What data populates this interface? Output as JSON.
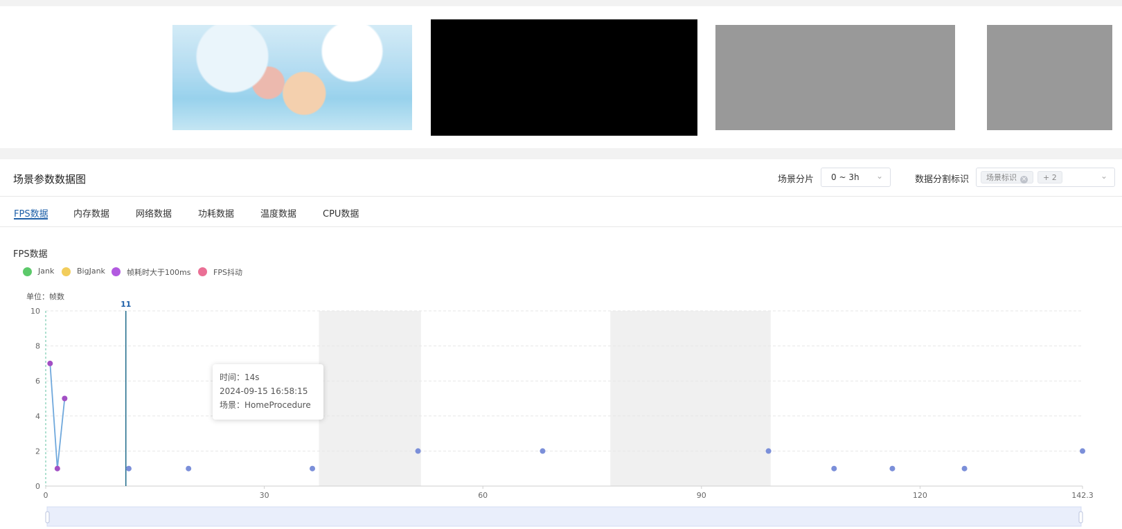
{
  "panel": {
    "title": "场景参数数据图",
    "scene_slice_label": "场景分片",
    "scene_slice_value": "0 ~ 3h",
    "split_label": "数据分割标识",
    "split_tag": "场景标识",
    "split_more": "+ 2"
  },
  "tabs": [
    "FPS数据",
    "内存数据",
    "网络数据",
    "功耗数据",
    "温度数据",
    "CPU数据"
  ],
  "active_tab": 0,
  "section_title": "FPS数据",
  "legend": [
    {
      "label": "Jank",
      "color": "#5cc96a"
    },
    {
      "label": "BigJank",
      "color": "#f2cd5c"
    },
    {
      "label": "帧耗时大于100ms",
      "color": "#b25ae0"
    },
    {
      "label": "FPS抖动",
      "color": "#ea6f95"
    }
  ],
  "tooltip": {
    "time": "时间：14s",
    "datetime": "2024-09-15 16:58:15",
    "scene": "场景：HomeProcedure"
  },
  "colors": {
    "accent": "#1d5fa8",
    "line": "#6fa8dc",
    "point": "#7b8fd9",
    "marked_point": "#a24fc4",
    "shade": "#f0f0f0"
  },
  "chart_data": {
    "type": "line",
    "unit_label": "单位：帧数",
    "xlim": [
      0,
      142.3
    ],
    "ylim": [
      0,
      10
    ],
    "x_ticks": [
      0,
      30,
      60,
      90,
      120,
      142.3
    ],
    "y_ticks": [
      0,
      2,
      4,
      6,
      8,
      10
    ],
    "grid": true,
    "cursor": {
      "x": 11,
      "label": "11"
    },
    "shaded_ranges": [
      [
        37.5,
        51.5
      ],
      [
        77.5,
        99.5
      ]
    ],
    "series": [
      {
        "points": [
          {
            "x": 0.6,
            "y": 7,
            "marked": true
          },
          {
            "x": 1.6,
            "y": 1,
            "marked": true
          },
          {
            "x": 2.6,
            "y": 5,
            "marked": true
          },
          {
            "x": 11.4,
            "y": 1
          },
          {
            "x": 19.6,
            "y": 1
          },
          {
            "x": 36.6,
            "y": 1
          },
          {
            "x": 51.1,
            "y": 2
          },
          {
            "x": 68.2,
            "y": 2
          },
          {
            "x": 99.2,
            "y": 2
          },
          {
            "x": 108.2,
            "y": 1
          },
          {
            "x": 116.2,
            "y": 1
          },
          {
            "x": 126.1,
            "y": 1
          },
          {
            "x": 142.3,
            "y": 2
          }
        ]
      }
    ]
  }
}
